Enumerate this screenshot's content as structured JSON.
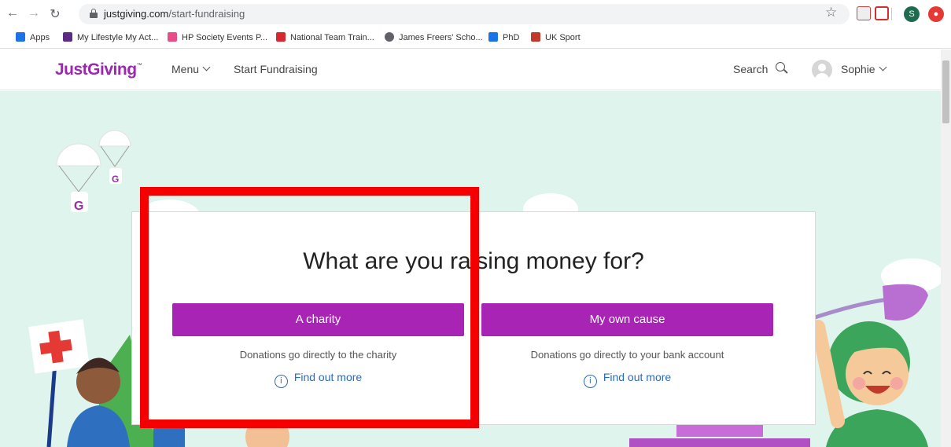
{
  "browser": {
    "url_host": "justgiving.com",
    "url_path": "/start-fundraising",
    "profile_initial": "S",
    "bookmarks": [
      {
        "label": "Apps",
        "color": "#1a73e8"
      },
      {
        "label": "My Lifestyle My Act...",
        "color": "#5b2c83"
      },
      {
        "label": "HP Society Events P...",
        "color": "#e94c89"
      },
      {
        "label": "National Team Train...",
        "color": "#d8282f"
      },
      {
        "label": "James Freers' Scho...",
        "color": "#5f6368"
      },
      {
        "label": "PhD",
        "color": "#1a73e8"
      },
      {
        "label": "UK Sport",
        "color": "#c0392b"
      }
    ]
  },
  "header": {
    "logo": "JustGiving",
    "logo_tm": "™",
    "menu_label": "Menu",
    "start_label": "Start Fundraising",
    "search_label": "Search",
    "user_name": "Sophie"
  },
  "card": {
    "title": "What are you raising money for?",
    "options": [
      {
        "button": "A charity",
        "description": "Donations go directly to the charity",
        "link": "Find out more"
      },
      {
        "button": "My own cause",
        "description": "Donations go directly to your bank account",
        "link": "Find out more"
      }
    ]
  },
  "colors": {
    "brand": "#9c27b0",
    "cta": "#a824b5",
    "hero_bg": "#dff4ec",
    "highlight": "#f50000",
    "link": "#2b6bb8"
  }
}
